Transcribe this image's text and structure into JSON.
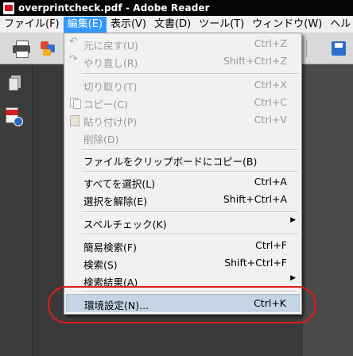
{
  "window": {
    "title": "overprintcheck.pdf - Adobe Reader"
  },
  "menubar": {
    "items": [
      "ファイル(F)",
      "編集(E)",
      "表示(V)",
      "文書(D)",
      "ツール(T)",
      "ウィンドウ(W)",
      "ヘル"
    ]
  },
  "edit_menu": {
    "items": [
      {
        "label": "元に戻す(U)",
        "shortcut": "Ctrl+Z",
        "enabled": false,
        "icon": "undo-icon"
      },
      {
        "label": "やり直し(R)",
        "shortcut": "Shift+Ctrl+Z",
        "enabled": false,
        "icon": "redo-icon"
      },
      {
        "label": "切り取り(T)",
        "shortcut": "Ctrl+X",
        "enabled": false
      },
      {
        "label": "コピー(C)",
        "shortcut": "Ctrl+C",
        "enabled": false,
        "icon": "copy-icon"
      },
      {
        "label": "貼り付け(P)",
        "shortcut": "Ctrl+V",
        "enabled": false,
        "icon": "paste-icon"
      },
      {
        "label": "削除(D)",
        "shortcut": "",
        "enabled": false
      },
      {
        "label": "ファイルをクリップボードにコピー(B)",
        "shortcut": "",
        "enabled": true
      },
      {
        "label": "すべてを選択(L)",
        "shortcut": "Ctrl+A",
        "enabled": true
      },
      {
        "label": "選択を解除(E)",
        "shortcut": "Shift+Ctrl+A",
        "enabled": true
      },
      {
        "label": "スペルチェック(K)",
        "shortcut": "",
        "enabled": true,
        "submenu": true
      },
      {
        "label": "簡易検索(F)",
        "shortcut": "Ctrl+F",
        "enabled": true
      },
      {
        "label": "検索(S)",
        "shortcut": "Shift+Ctrl+F",
        "enabled": true
      },
      {
        "label": "検索結果(A)",
        "shortcut": "",
        "enabled": true,
        "submenu": true
      },
      {
        "label": "環境設定(N)...",
        "shortcut": "Ctrl+K",
        "enabled": true,
        "highlighted": true
      }
    ]
  },
  "colors": {
    "highlight_circle": "#e01b1b",
    "menu_highlight": "#c5d5e6",
    "active_menu": "#3399ff"
  }
}
